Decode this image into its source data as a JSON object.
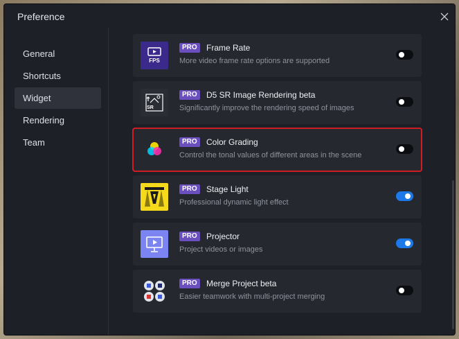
{
  "window": {
    "title": "Preference"
  },
  "sidebar": {
    "items": [
      {
        "label": "General",
        "active": false
      },
      {
        "label": "Shortcuts",
        "active": false
      },
      {
        "label": "Widget",
        "active": true
      },
      {
        "label": "Rendering",
        "active": false
      },
      {
        "label": "Team",
        "active": false
      }
    ]
  },
  "widgets": [
    {
      "badge": "PRO",
      "name": "Frame Rate",
      "desc": "More video frame rate options are supported",
      "icon": "fps-icon",
      "enabled": false
    },
    {
      "badge": "PRO",
      "name": "D5 SR Image Rendering beta",
      "desc": "Significantly improve the rendering speed of images",
      "icon": "sr-image-icon",
      "enabled": false
    },
    {
      "badge": "PRO",
      "name": "Color Grading",
      "desc": "Control the tonal values of different areas in the scene",
      "icon": "color-grading-icon",
      "enabled": false,
      "highlighted": true
    },
    {
      "badge": "PRO",
      "name": "Stage Light",
      "desc": "Professional dynamic light effect",
      "icon": "stage-light-icon",
      "enabled": true
    },
    {
      "badge": "PRO",
      "name": "Projector",
      "desc": "Project videos or images",
      "icon": "projector-icon",
      "enabled": true
    },
    {
      "badge": "PRO",
      "name": "Merge Project beta",
      "desc": "Easier teamwork with multi-project merging",
      "icon": "merge-project-icon",
      "enabled": false
    }
  ],
  "colors": {
    "accent": "#1d79e8",
    "badge": "#6b4fbf",
    "highlight": "#d11c24",
    "background": "#1e2027",
    "card": "#262830"
  }
}
